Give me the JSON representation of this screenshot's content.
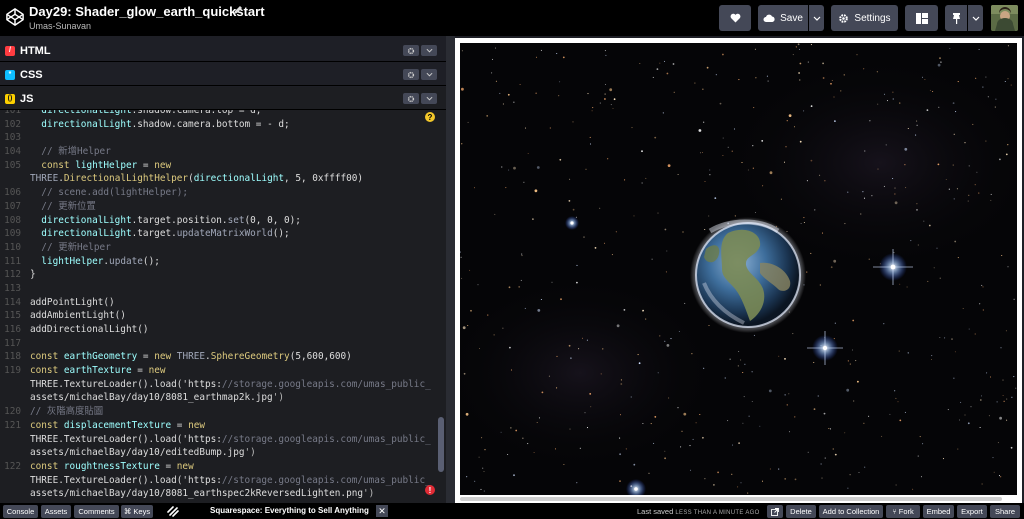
{
  "header": {
    "title": "Day29: Shader_glow_earth_quickstart",
    "author": "Umas-Sunavan",
    "save_label": "Save",
    "settings_label": "Settings"
  },
  "panels": {
    "html_label": "HTML",
    "css_label": "CSS",
    "js_label": "JS"
  },
  "code": {
    "lines": [
      {
        "n": "101",
        "t": "  directionalLight.shadow.camera.top = d;"
      },
      {
        "n": "102",
        "t": "  directionalLight.shadow.camera.bottom = - d;"
      },
      {
        "n": "103",
        "t": ""
      },
      {
        "n": "104",
        "t": "  // 新增Helper"
      },
      {
        "n": "105",
        "t": "  const lightHelper = new"
      },
      {
        "n": "",
        "t": "THREE.DirectionalLightHelper(directionalLight, 5, 0xffff00)"
      },
      {
        "n": "106",
        "t": "  // scene.add(lightHelper);"
      },
      {
        "n": "107",
        "t": "  // 更新位置"
      },
      {
        "n": "108",
        "t": "  directionalLight.target.position.set(0, 0, 0);"
      },
      {
        "n": "109",
        "t": "  directionalLight.target.updateMatrixWorld();"
      },
      {
        "n": "110",
        "t": "  // 更新Helper"
      },
      {
        "n": "111",
        "t": "  lightHelper.update();"
      },
      {
        "n": "112",
        "t": "}"
      },
      {
        "n": "113",
        "t": ""
      },
      {
        "n": "114",
        "t": "addPointLight()"
      },
      {
        "n": "115",
        "t": "addAmbientLight()"
      },
      {
        "n": "116",
        "t": "addDirectionalLight()"
      },
      {
        "n": "117",
        "t": ""
      },
      {
        "n": "118",
        "t": "const earthGeometry = new THREE.SphereGeometry(5,600,600)"
      },
      {
        "n": "119",
        "t": "const earthTexture = new"
      },
      {
        "n": "",
        "t": "THREE.TextureLoader().load('https://storage.googleapis.com/umas_public_"
      },
      {
        "n": "",
        "t": "assets/michaelBay/day10/8081_earthmap2k.jpg')"
      },
      {
        "n": "120",
        "t": "// 灰階高度貼圖"
      },
      {
        "n": "121",
        "t": "const displacementTexture = new"
      },
      {
        "n": "",
        "t": "THREE.TextureLoader().load('https://storage.googleapis.com/umas_public_"
      },
      {
        "n": "",
        "t": "assets/michaelBay/day10/editedBump.jpg')"
      },
      {
        "n": "122",
        "t": "const roughtnessTexture = new"
      },
      {
        "n": "",
        "t": "THREE.TextureLoader().load('https://storage.googleapis.com/umas_public_"
      },
      {
        "n": "",
        "t": "assets/michaelBay/day10/8081_earthspec2kReversedLighten.png')"
      }
    ]
  },
  "footer": {
    "console_label": "Console",
    "assets_label": "Assets",
    "comments_label": "Comments",
    "keys_label": "Keys",
    "ad_text": "Squarespace: Everything to Sell Anything",
    "last_saved_label": "Last saved",
    "last_saved_time": "LESS THAN A MINUTE AGO",
    "delete_label": "Delete",
    "add_collection_label": "Add to Collection",
    "fork_label": "Fork",
    "embed_label": "Embed",
    "export_label": "Export",
    "share_label": "Share"
  },
  "colors": {
    "header_bg": "#000000",
    "button_bg": "#444857",
    "editor_bg": "#1d1e22",
    "active_tab_accent": "#47cf73",
    "html_badge": "#ff3c41",
    "css_badge": "#0ebeff",
    "js_badge": "#fcd000"
  },
  "icons": {
    "logo": "codepen-logo-icon",
    "heart": "heart-icon",
    "cloud": "cloud-icon",
    "gear": "gear-icon",
    "layout": "layout-grid-icon",
    "pin": "pin-icon"
  }
}
